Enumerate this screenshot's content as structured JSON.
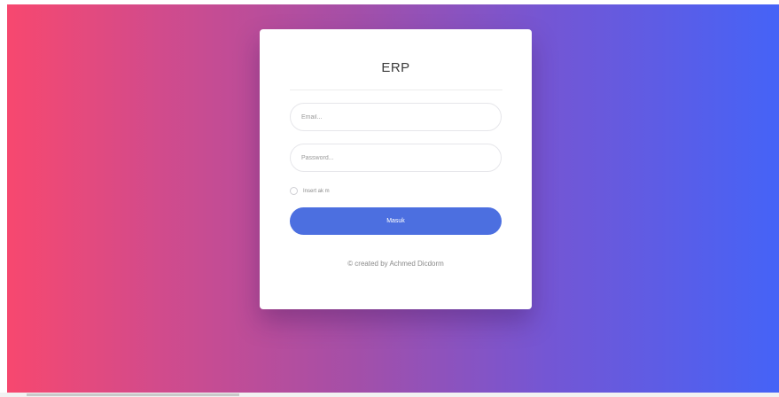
{
  "login": {
    "title": "ERP",
    "email_placeholder": "Email...",
    "password_placeholder": "Password...",
    "remember_label": "Insert ak m",
    "submit_label": "Masuk",
    "credit": "© created by Achmed Dicdorm"
  },
  "colors": {
    "gradient_left": "#f7486f",
    "gradient_right": "#4563f7",
    "button": "#4c6fe0"
  }
}
